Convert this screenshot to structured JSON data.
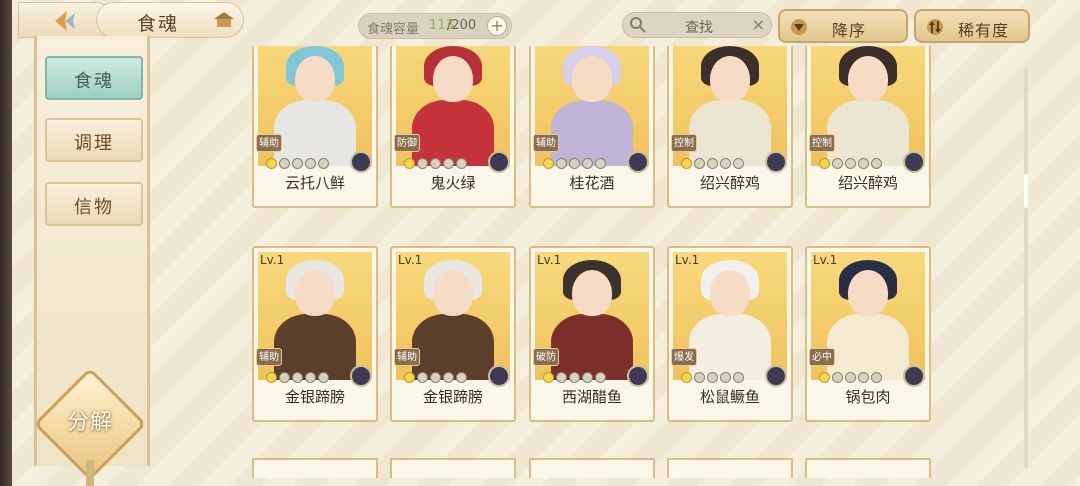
{
  "header": {
    "title": "食魂",
    "capacity_label": "食魂容量",
    "capacity_current": "113",
    "capacity_max": "/200",
    "capacity_add": "+",
    "search_placeholder": "查找",
    "search_clear": "×",
    "sort_label": "降序",
    "rarity_label": "稀有度"
  },
  "sidebar": {
    "tabs": [
      {
        "label": "食魂",
        "active": true
      },
      {
        "label": "调理",
        "active": false
      },
      {
        "label": "信物",
        "active": false
      }
    ],
    "decompose_label": "分解"
  },
  "cards": [
    {
      "level": "",
      "role": "辅助",
      "name": "云托八鲜",
      "stars": 1,
      "hair": "#7fc7d6",
      "body": "#e8e6e3"
    },
    {
      "level": "",
      "role": "防御",
      "name": "鬼火绿",
      "stars": 1,
      "hair": "#b5323a",
      "body": "#c6343b"
    },
    {
      "level": "",
      "role": "辅助",
      "name": "桂花酒",
      "stars": 1,
      "hair": "#d8cfe8",
      "body": "#bfb4d6"
    },
    {
      "level": "",
      "role": "控制",
      "name": "绍兴醉鸡",
      "stars": 1,
      "hair": "#3c2f2b",
      "body": "#ece5d2"
    },
    {
      "level": "",
      "role": "控制",
      "name": "绍兴醉鸡",
      "stars": 1,
      "hair": "#3c2f2b",
      "body": "#ece5d2"
    },
    {
      "level": "Lv.1",
      "role": "辅助",
      "name": "金银蹄膀",
      "stars": 1,
      "hair": "#eae6e1",
      "body": "#5b3e2b"
    },
    {
      "level": "Lv.1",
      "role": "辅助",
      "name": "金银蹄膀",
      "stars": 1,
      "hair": "#eae6e1",
      "body": "#5b3e2b"
    },
    {
      "level": "Lv.1",
      "role": "破防",
      "name": "西湖醋鱼",
      "stars": 1,
      "hair": "#3a332c",
      "body": "#7b2e2a"
    },
    {
      "level": "Lv.1",
      "role": "爆发",
      "name": "松鼠鳜鱼",
      "stars": 1,
      "hair": "#f2efec",
      "body": "#f3eee1"
    },
    {
      "level": "Lv.1",
      "role": "必中",
      "name": "锅包肉",
      "stars": 1,
      "hair": "#2a2f45",
      "body": "#f4ead2"
    }
  ],
  "colors": {
    "accent_gold": "#d9bd83",
    "active_tab": "#9ed0c3",
    "capacity_current": "#8fb24a"
  }
}
